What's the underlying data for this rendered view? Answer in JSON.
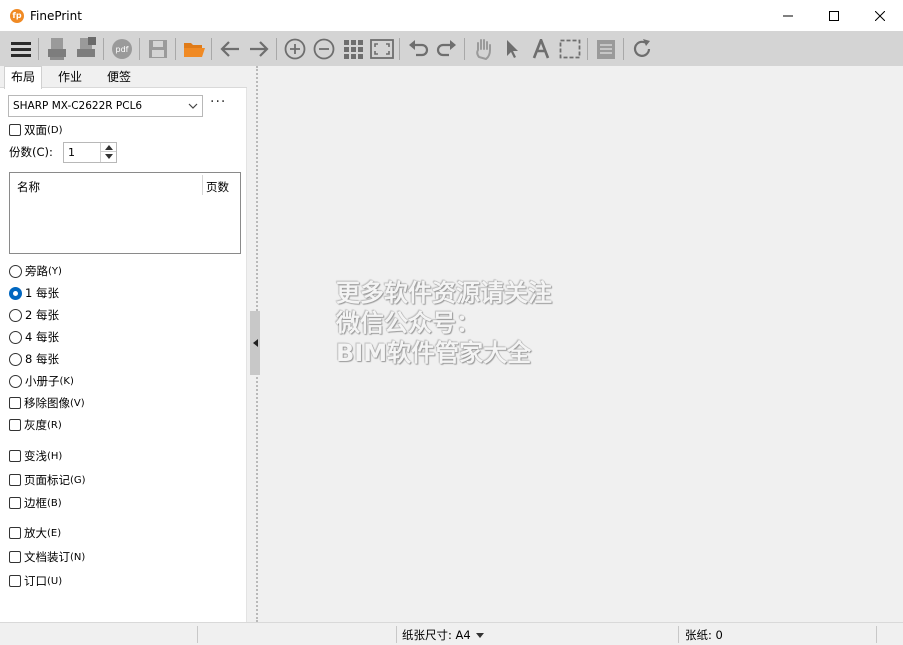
{
  "window": {
    "title": "FinePrint"
  },
  "toolbar": {
    "icons": [
      "menu-icon",
      "printer-icon",
      "print-settings-icon",
      "pdf-icon",
      "save-icon",
      "open-folder-icon",
      "arrow-left-icon",
      "arrow-right-icon",
      "zoom-in-icon",
      "zoom-out-icon",
      "grid-icon",
      "fit-page-icon",
      "undo-icon",
      "redo-icon",
      "hand-icon",
      "pointer-icon",
      "text-icon",
      "select-icon",
      "notes-icon",
      "refresh-icon"
    ],
    "accent_color": "#f08a24"
  },
  "tabs": [
    {
      "label": "布局",
      "active": true
    },
    {
      "label": "作业",
      "active": false
    },
    {
      "label": "便签",
      "active": false
    }
  ],
  "printer": {
    "selected": "SHARP MX-C2622R PCL6",
    "more_label": "···"
  },
  "duplex": {
    "label": "双面",
    "key": "(D)",
    "checked": false
  },
  "copies": {
    "label": "份数(C):",
    "value": "1"
  },
  "job_list": {
    "col_name": "名称",
    "col_pages": "页数"
  },
  "layout_options": [
    {
      "label": "旁路",
      "key": "(Y)",
      "checked": false
    },
    {
      "label": "1 每张",
      "key": "",
      "checked": true
    },
    {
      "label": "2 每张",
      "key": "",
      "checked": false
    },
    {
      "label": "4 每张",
      "key": "",
      "checked": false
    },
    {
      "label": "8 每张",
      "key": "",
      "checked": false
    },
    {
      "label": "小册子",
      "key": "(K)",
      "checked": false
    }
  ],
  "checkboxes": {
    "remove_images": {
      "label": "移除图像",
      "key": "(V)"
    },
    "grayscale": {
      "label": "灰度",
      "key": "(R)"
    },
    "lighten": {
      "label": "变浅",
      "key": "(H)"
    },
    "page_marks": {
      "label": "页面标记",
      "key": "(G)"
    },
    "border": {
      "label": "边框",
      "key": "(B)"
    },
    "enlarge": {
      "label": "放大",
      "key": "(E)"
    },
    "binding": {
      "label": "文档装订",
      "key": "(N)"
    },
    "gutter": {
      "label": "订口",
      "key": "(U)"
    }
  },
  "watermark": {
    "line1": "更多软件资源请关注",
    "line2": "微信公众号：",
    "line3": "BIM软件管家大全"
  },
  "status": {
    "paper_size_label": "纸张尺寸: A4",
    "sheets_label": "张纸:  0"
  }
}
